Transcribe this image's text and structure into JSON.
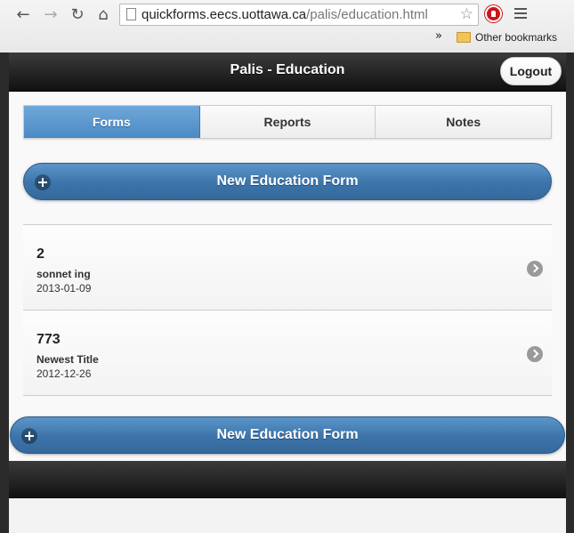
{
  "browser": {
    "url_host": "quickforms.eecs.uottawa.ca",
    "url_path": "/palis/education.html",
    "bookmarks_overflow": "»",
    "bookmarks_folder": "Other bookmarks",
    "icons": [
      "back-icon",
      "forward-icon",
      "reload-icon",
      "home-icon",
      "page-icon",
      "star-icon",
      "stop-extension-icon",
      "menu-icon",
      "folder-icon"
    ]
  },
  "header": {
    "title": "Palis - Education",
    "logout_label": "Logout"
  },
  "tabs": [
    {
      "label": "Forms",
      "active": true
    },
    {
      "label": "Reports",
      "active": false
    },
    {
      "label": "Notes",
      "active": false
    }
  ],
  "new_button_label": "New Education Form",
  "forms": [
    {
      "id": "2",
      "title": "sonnet ing",
      "date": "2013-01-09"
    },
    {
      "id": "773",
      "title": "Newest Title",
      "date": "2012-12-26"
    }
  ],
  "colors": {
    "active_tab": "#5b98d0",
    "button_blue": "#3c74aa",
    "header_dark": "#1a1a1a"
  }
}
